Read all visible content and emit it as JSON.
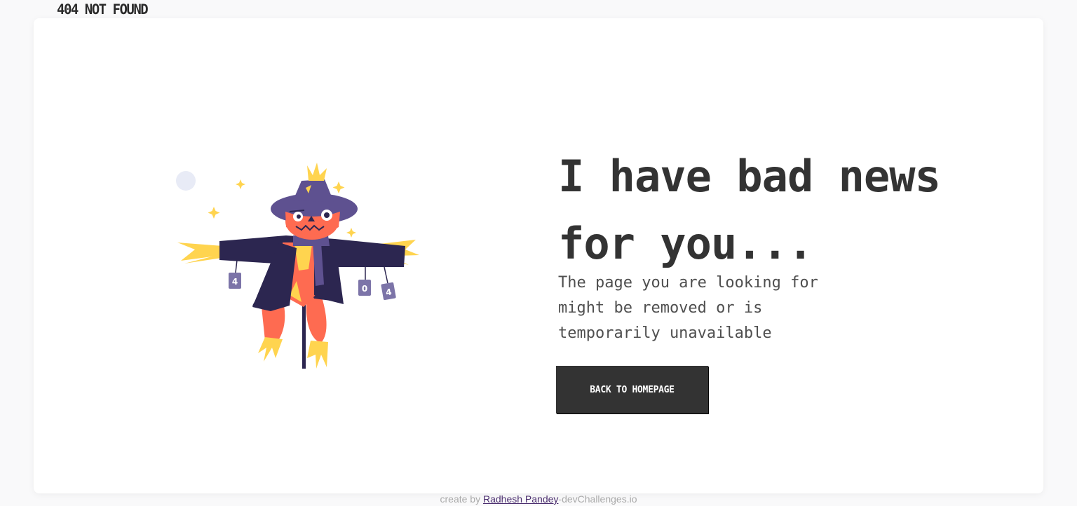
{
  "brand": {
    "label": "404 NOT FOUND"
  },
  "main": {
    "headline": "I have bad news for you...",
    "description": "The page you are looking for might be removed or is temporarily unavailable",
    "button_label": "BACK TO HOMEPAGE",
    "illustration": {
      "name": "scarecrow-illustration",
      "can_labels": [
        "4",
        "0",
        "4"
      ]
    }
  },
  "footer": {
    "prefix": "create by",
    "author": "Radhesh Pandey",
    "suffix": "-devChallenges.io"
  },
  "colors": {
    "background": "#f9f9fa",
    "card": "#ffffff",
    "text": "#333333",
    "button": "#333333",
    "button_text": "#ffffff",
    "scarecrow_coat": "#2c2650",
    "scarecrow_hat": "#5e5190",
    "scarecrow_face": "#fe6b51",
    "straw": "#ffd44f",
    "link": "#4a2d6e"
  }
}
